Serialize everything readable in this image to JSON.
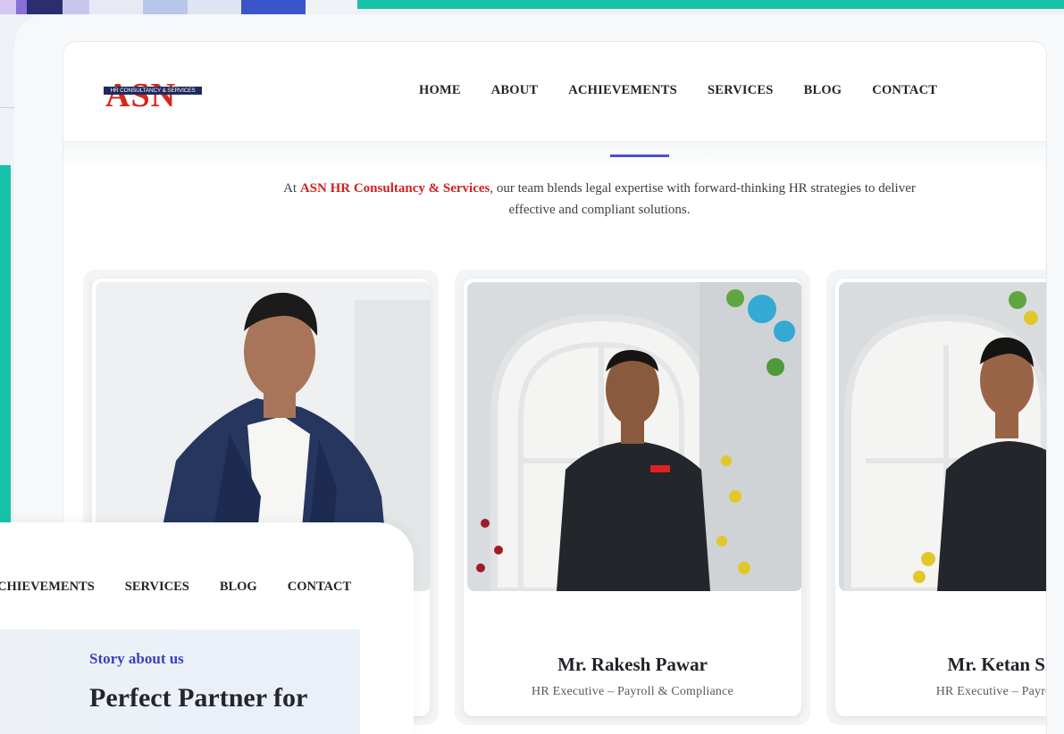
{
  "site": {
    "logo_text": "ASN",
    "logo_tagline": "HR CONSULTANCY & SERVICES",
    "nav": [
      "HOME",
      "ABOUT",
      "ACHIEVEMENTS",
      "SERVICES",
      "BLOG",
      "CONTACT"
    ]
  },
  "intro": {
    "prefix": "At ",
    "company": "ASN HR Consultancy & Services",
    "suffix": ", our team blends legal expertise with forward-thinking HR strategies to deliver effective and compliant solutions."
  },
  "team": [
    {
      "name": "",
      "role": ""
    },
    {
      "name": "Mr. Rakesh Pawar",
      "role": "HR Executive – Payroll & Compliance"
    },
    {
      "name": "Mr. Ketan Shi",
      "role": "HR Executive – Payroll &"
    }
  ],
  "overlay": {
    "nav": [
      "CHIEVEMENTS",
      "SERVICES",
      "BLOG",
      "CONTACT"
    ],
    "eyebrow": "Story about us",
    "headline": "Perfect Partner for"
  },
  "colors": {
    "accent_teal": "#17c3a8",
    "brand_red": "#d9261c",
    "accent_blue": "#4b4fd6"
  }
}
